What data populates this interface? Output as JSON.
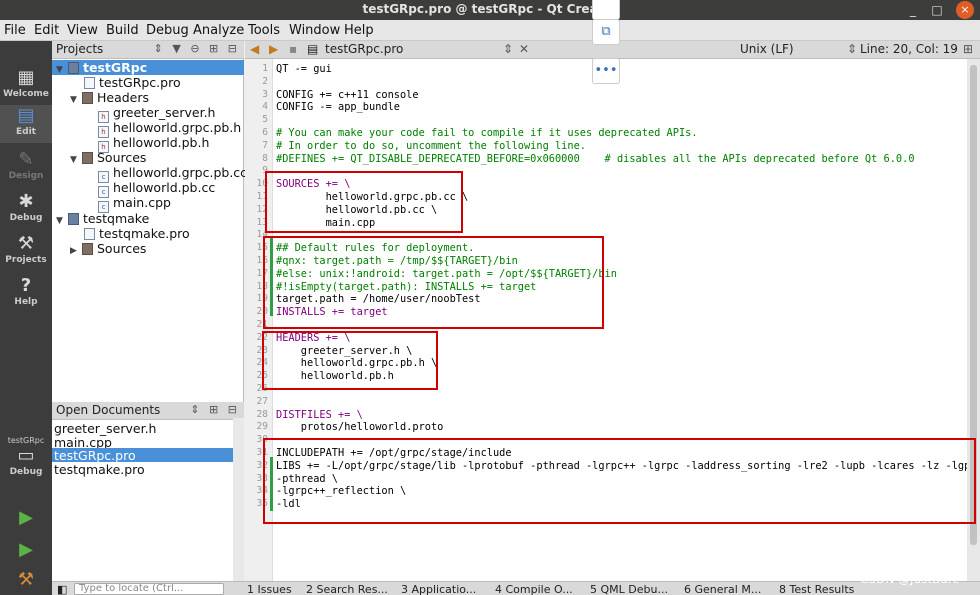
{
  "window": {
    "title": "testGRpc.pro @ testGRpc - Qt Creator",
    "minimize_glyph": "_",
    "restore_glyph": "□",
    "close_glyph": "×"
  },
  "menu": [
    "File",
    "Edit",
    "View",
    "Build",
    "Debug",
    "Analyze",
    "Tools",
    "Window",
    "Help"
  ],
  "modes": [
    {
      "label": "Welcome",
      "icon": "grid-icon"
    },
    {
      "label": "Edit",
      "icon": "document-icon"
    },
    {
      "label": "Design",
      "icon": "pencil-icon"
    },
    {
      "label": "Debug",
      "icon": "bug-icon"
    },
    {
      "label": "Projects",
      "icon": "wrench-icon"
    },
    {
      "label": "Help",
      "icon": "help-icon"
    }
  ],
  "kit": {
    "project": "testGRpc",
    "label": "Debug"
  },
  "projects_pane": {
    "title": "Projects",
    "tree": [
      "testGRpc",
      "testGRpc.pro",
      "Headers",
      "greeter_server.h",
      "helloworld.grpc.pb.h",
      "helloworld.pb.h",
      "Sources",
      "helloworld.grpc.pb.cc",
      "helloworld.pb.cc",
      "main.cpp",
      "testqmake",
      "testqmake.pro",
      "Sources"
    ]
  },
  "open_documents": {
    "title": "Open Documents",
    "files": [
      "greeter_server.h",
      "main.cpp",
      "testGRpc.pro",
      "testqmake.pro"
    ],
    "selected": "testGRpc.pro"
  },
  "editor": {
    "file": "testGRpc.pro",
    "line_ending": "Unix (LF)",
    "cursor": "Line: 20, Col: 19",
    "lines": [
      "QT -= gui",
      "",
      "CONFIG += c++11 console",
      "CONFIG -= app_bundle",
      "",
      "# You can make your code fail to compile if it uses deprecated APIs.",
      "# In order to do so, uncomment the following line.",
      "#DEFINES += QT_DISABLE_DEPRECATED_BEFORE=0x060000    # disables all the APIs deprecated before Qt 6.0.0",
      "",
      "SOURCES += \\",
      "        helloworld.grpc.pb.cc \\",
      "        helloworld.pb.cc \\",
      "        main.cpp",
      "",
      "## Default rules for deployment.",
      "#qnx: target.path = /tmp/$${TARGET}/bin",
      "#else: unix:!android: target.path = /opt/$${TARGET}/bin",
      "#!isEmpty(target.path): INSTALLS += target",
      "target.path = /home/user/noobTest",
      "INSTALLS += target",
      "",
      "HEADERS += \\",
      "    greeter_server.h \\",
      "    helloworld.grpc.pb.h \\",
      "    helloworld.pb.h",
      "",
      "",
      "DISTFILES += \\",
      "    protos/helloworld.proto",
      "",
      "INCLUDEPATH += /opt/grpc/stage/include",
      "LIBS += -L/opt/grpc/stage/lib -lprotobuf -pthread -lgrpc++ -lgrpc -laddress_sorting -lre2 -lupb -lcares -lz -lgpr -lssl -",
      "-pthread \\",
      "-lgrpc++_reflection \\",
      "-ldl"
    ]
  },
  "statusbar": {
    "locate_placeholder": "Type to locate (Ctrl...",
    "tabs": [
      "1 Issues",
      "2 Search Res...",
      "3 Applicatio...",
      "4 Compile O...",
      "5 QML Debu...",
      "6 General M...",
      "8 Test Results"
    ]
  },
  "watermark": "CSDN @JustBarc"
}
